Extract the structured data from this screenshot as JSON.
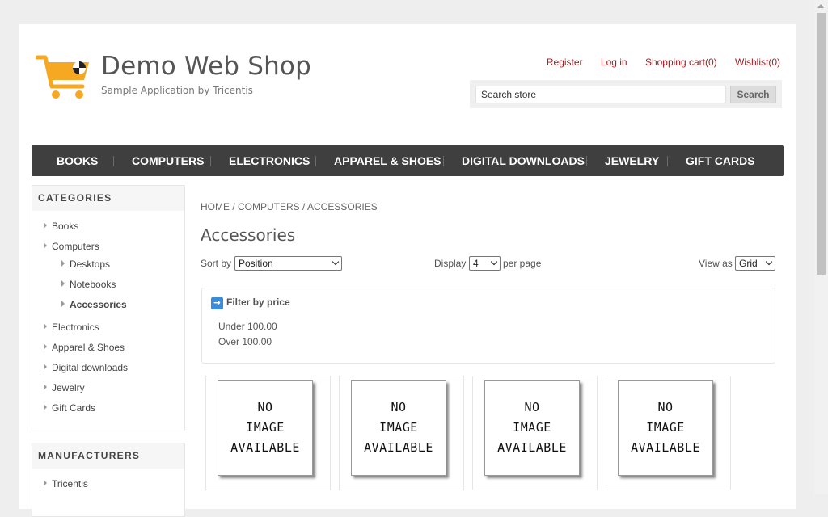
{
  "header": {
    "title": "Demo Web Shop",
    "subtitle": "Sample Application by Tricentis",
    "links": {
      "register": "Register",
      "login": "Log in",
      "cart": "Shopping cart(0)",
      "wishlist": "Wishlist(0)"
    },
    "search": {
      "value": "Search store",
      "button": "Search"
    }
  },
  "top_menu": [
    "BOOKS",
    "COMPUTERS",
    "ELECTRONICS",
    "APPAREL & SHOES",
    "DIGITAL DOWNLOADS",
    "JEWELRY",
    "GIFT CARDS"
  ],
  "categories": {
    "title": "CATEGORIES",
    "items": [
      "Books",
      "Computers",
      "Desktops",
      "Notebooks",
      "Accessories",
      "Electronics",
      "Apparel & Shoes",
      "Digital downloads",
      "Jewelry",
      "Gift Cards"
    ]
  },
  "manufacturers": {
    "title": "MANUFACTURERS",
    "items": [
      "Tricentis"
    ]
  },
  "breadcrumb": "HOME / COMPUTERS / ACCESSORIES",
  "page_title": "Accessories",
  "controls": {
    "sort_label": "Sort by",
    "sort_value": "Position",
    "display_label": "Display",
    "display_value": "4",
    "per_page": "per page",
    "view_label": "View as",
    "view_value": "Grid"
  },
  "filter": {
    "title": "Filter by price",
    "options": [
      "Under 100.00",
      "Over 100.00"
    ]
  },
  "products": [
    {
      "image_lines": [
        "NO",
        "IMAGE",
        "AVAILABLE"
      ]
    },
    {
      "image_lines": [
        "NO",
        "IMAGE",
        "AVAILABLE"
      ]
    },
    {
      "image_lines": [
        "NO",
        "IMAGE",
        "AVAILABLE"
      ]
    },
    {
      "image_lines": [
        "NO",
        "IMAGE",
        "AVAILABLE"
      ]
    }
  ],
  "colors": {
    "link": "#a01c20",
    "logo": "#f7a823",
    "menu_bg": "#3f3f3f"
  }
}
